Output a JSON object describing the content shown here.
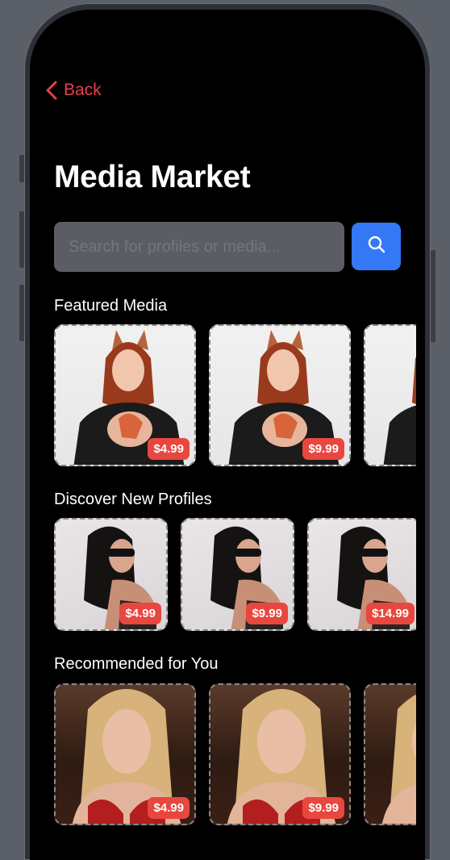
{
  "nav": {
    "back_label": "Back"
  },
  "page": {
    "title": "Media Market"
  },
  "search": {
    "placeholder": "Search for profiles or media..."
  },
  "sections": {
    "featured": {
      "title": "Featured Media",
      "items": [
        {
          "price": "$4.99"
        },
        {
          "price": "$9.99"
        },
        {
          "price": ""
        }
      ]
    },
    "discover": {
      "title": "Discover New Profiles",
      "items": [
        {
          "price": "$4.99"
        },
        {
          "price": "$9.99"
        },
        {
          "price": "$14.99"
        }
      ]
    },
    "recommended": {
      "title": "Recommended for You",
      "items": [
        {
          "price": "$4.99"
        },
        {
          "price": "$9.99"
        },
        {
          "price": ""
        }
      ]
    }
  },
  "colors": {
    "accent": "#3478f6",
    "back": "#e0434b",
    "price_badge": "#e8473f",
    "background": "#000000"
  },
  "icons": {
    "back": "chevron-left-icon",
    "search": "search-icon"
  }
}
